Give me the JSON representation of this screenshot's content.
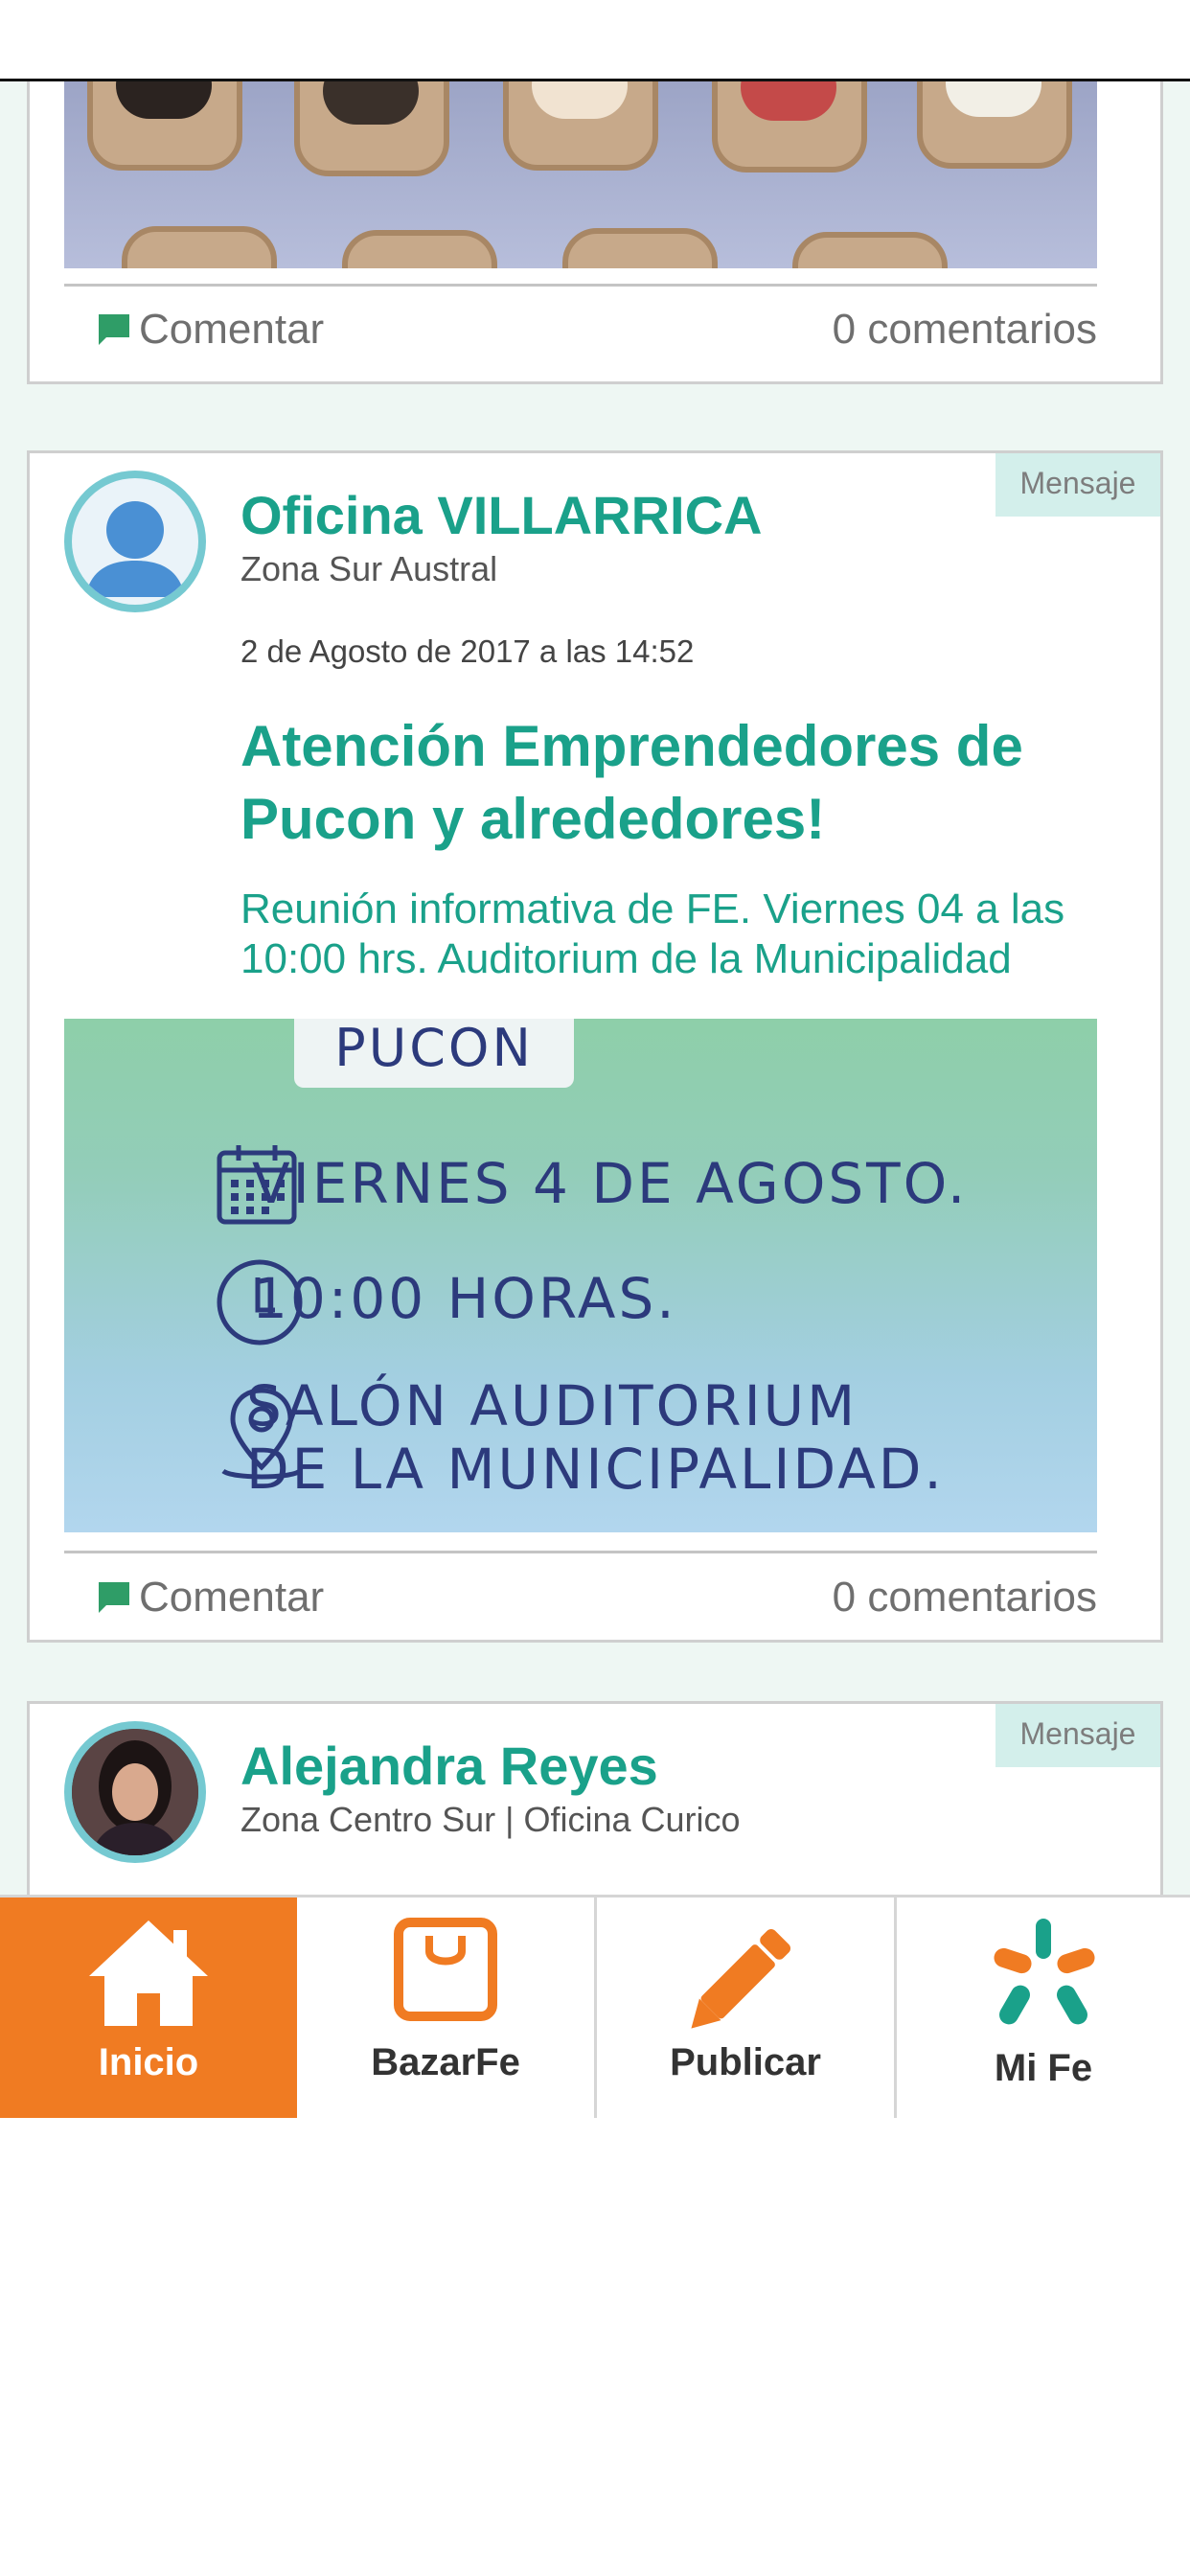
{
  "posts": [
    {
      "comment_label": "Comentar",
      "comment_count": "0 comentarios"
    },
    {
      "badge": "Mensaje",
      "author": "Oficina VILLARRICA",
      "zone": "Zona Sur Austral",
      "date": "2 de Agosto de 2017 a las 14:52",
      "title": "Atención Emprendedores de Pucon y alrededores!",
      "body": "Reunión informativa de FE. Viernes 04 a las 10:00 hrs. Auditorium de la Municipalidad",
      "poster": {
        "heading": "PUCON",
        "line1": "VIERNES 4 DE AGOSTO.",
        "line2": "10:00 HORAS.",
        "line3a": "SALÓN AUDITORIUM",
        "line3b": "DE LA MUNICIPALIDAD."
      },
      "comment_label": "Comentar",
      "comment_count": "0 comentarios"
    },
    {
      "badge": "Mensaje",
      "author": "Alejandra Reyes",
      "zone": "Zona Centro Sur | Oficina Curico"
    }
  ],
  "nav": {
    "items": [
      {
        "label": "Inicio",
        "icon": "home-icon"
      },
      {
        "label": "BazarFe",
        "icon": "shopping-bag-icon"
      },
      {
        "label": "Publicar",
        "icon": "pencil-icon"
      },
      {
        "label": "Mi Fe",
        "icon": "fe-logo-icon"
      }
    ],
    "active": "Inicio"
  },
  "colors": {
    "accent_green": "#1aa18a",
    "accent_orange": "#f07b22",
    "badge_bg": "#d3efeb",
    "feed_bg": "#eef7f3"
  }
}
